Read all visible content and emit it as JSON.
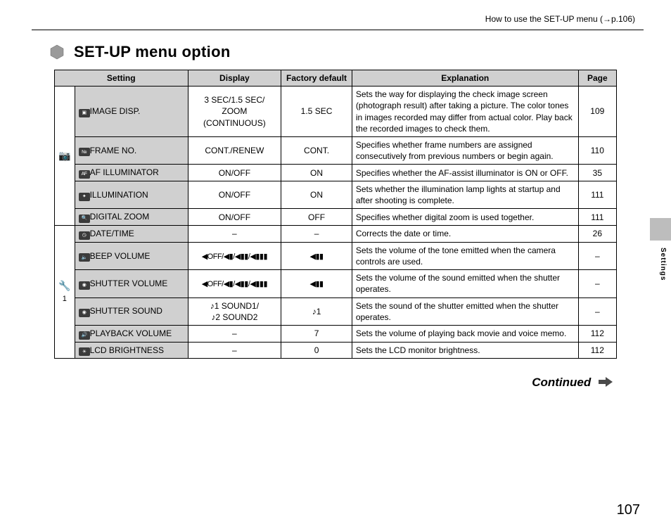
{
  "top_reference": "How to use the SET-UP menu (→p.106)",
  "heading": "SET-UP menu option",
  "headers": {
    "setting": "Setting",
    "display": "Display",
    "default": "Factory default",
    "explanation": "Explanation",
    "page": "Page"
  },
  "group1_icon": "📷",
  "group2_icon": "🔧1",
  "rows": [
    {
      "icon": "▣",
      "setting": "IMAGE DISP.",
      "display": "3 SEC/1.5 SEC/\nZOOM (CONTINUOUS)",
      "default": "1.5 SEC",
      "explanation": "Sets the way for displaying the check image screen (photograph result) after taking a picture. The color tones in images recorded may differ from actual color. Play back the recorded images to check them.",
      "page": "109"
    },
    {
      "icon": "№",
      "setting": "FRAME NO.",
      "display": "CONT./RENEW",
      "default": "CONT.",
      "explanation": "Specifies whether frame numbers are assigned consecutively from previous numbers or begin again.",
      "page": "110"
    },
    {
      "icon": "AF",
      "setting": "AF ILLUMINATOR",
      "display": "ON/OFF",
      "default": "ON",
      "explanation": "Specifies whether the AF-assist illuminator is ON or OFF.",
      "page": "35"
    },
    {
      "icon": "✦",
      "setting": "ILLUMINATION",
      "display": "ON/OFF",
      "default": "ON",
      "explanation": "Sets whether the illumination lamp lights at startup and after shooting is complete.",
      "page": "111"
    },
    {
      "icon": "🔍",
      "setting": "DIGITAL ZOOM",
      "display": "ON/OFF",
      "default": "OFF",
      "explanation": "Specifies whether digital zoom is used together.",
      "page": "111"
    },
    {
      "icon": "◷",
      "setting": "DATE/TIME",
      "display": "–",
      "default": "–",
      "explanation": "Corrects the date or time.",
      "page": "26"
    },
    {
      "icon": "🔈",
      "setting": "BEEP VOLUME",
      "display": "vol",
      "default": "vol-mid",
      "explanation": "Sets the volume of the tone emitted when the camera controls are used.",
      "page": "–"
    },
    {
      "icon": "◉",
      "setting": "SHUTTER VOLUME",
      "display": "vol",
      "default": "vol-mid",
      "explanation": "Sets the volume of the sound emitted when the shutter operates.",
      "page": "–"
    },
    {
      "icon": "◉",
      "setting": "SHUTTER SOUND",
      "display": "♪1 SOUND1/\n♪2 SOUND2",
      "default": "♪1",
      "explanation": "Sets the sound of the shutter emitted when the shutter operates.",
      "page": "–"
    },
    {
      "icon": "🔊",
      "setting": "PLAYBACK VOLUME",
      "display": "–",
      "default": "7",
      "explanation": "Sets the volume of playing back movie and voice memo.",
      "page": "112"
    },
    {
      "icon": "☀",
      "setting": "LCD BRIGHTNESS",
      "display": "–",
      "default": "0",
      "explanation": "Sets the LCD monitor brightness.",
      "page": "112"
    }
  ],
  "continued": "Continued",
  "side_label": "Settings",
  "page_number": "107"
}
